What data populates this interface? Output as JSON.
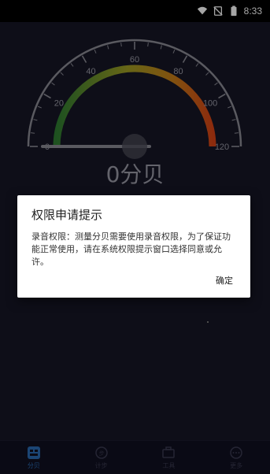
{
  "status_bar": {
    "time": "8:33"
  },
  "gauge": {
    "ticks": [
      "0",
      "20",
      "40",
      "60",
      "80",
      "100",
      "120"
    ],
    "range": [
      0,
      120
    ],
    "readout": "0分贝",
    "colors": {
      "low": "#2e7d32",
      "mid": "#9e9d24",
      "high": "#d84315"
    }
  },
  "dialog": {
    "title": "权限申请提示",
    "body": "录音权限：测量分贝需要使用录音权限，为了保证功能正常使用，请在系统权限提示窗口选择同意或允许。",
    "confirm_label": "确定"
  },
  "tabs": [
    {
      "label": "分贝",
      "icon": "decibel-icon",
      "active": true
    },
    {
      "label": "计步",
      "icon": "steps-icon",
      "active": false
    },
    {
      "label": "工具",
      "icon": "toolbox-icon",
      "active": false
    },
    {
      "label": "更多",
      "icon": "more-icon",
      "active": false
    }
  ],
  "accent_color": "#2a6bb2"
}
